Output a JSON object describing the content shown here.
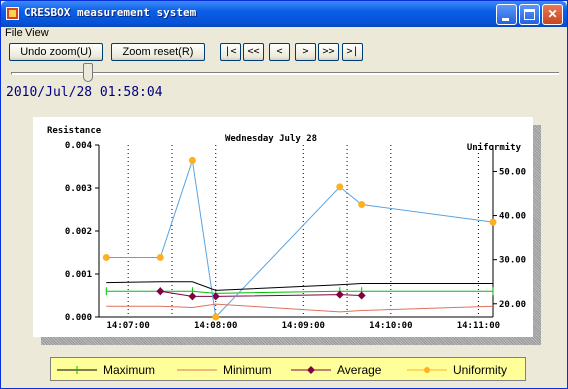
{
  "window": {
    "title": "CRESBOX measurement system",
    "min_glyph": "",
    "max_glyph": "",
    "close_glyph": "✕"
  },
  "menu": {
    "file": "File",
    "view": "View"
  },
  "toolbar": {
    "undo_zoom": "Undo zoom(U)",
    "zoom_reset": "Zoom reset(R)",
    "nav": [
      "|<",
      "<<",
      "<",
      ">",
      ">>",
      ">|"
    ]
  },
  "slider": {
    "value_fraction": 0.14
  },
  "timestamp": "2010/Jul/28 01:58:04",
  "colors": {
    "maximum": "#00c000",
    "minimum": "#e07060",
    "average": "#800040",
    "uniformity": "#ffb020",
    "uniformity_line": "#5ba3e0",
    "black_line": "#000000"
  },
  "chart_data": {
    "type": "line",
    "title": "Wednesday July 28",
    "ylabel": "Resistance",
    "y2label": "Uniformity",
    "xticks": [
      "14:07:00",
      "14:08:00",
      "14:09:00",
      "14:10:00",
      "14:11:00"
    ],
    "yticks": [
      "0.000",
      "0.001",
      "0.002",
      "0.003",
      "0.004"
    ],
    "y2ticks": [
      "20.00",
      "30.00",
      "40.00",
      "50.00"
    ],
    "ylim": [
      0,
      0.004
    ],
    "y2lim": [
      17,
      56
    ],
    "x": [
      "14:06:45",
      "14:07:22",
      "14:07:44",
      "14:08:00",
      "14:09:25",
      "14:09:40",
      "14:11:10"
    ],
    "series": [
      {
        "name": "Maximum",
        "axis": "y",
        "values": [
          0.0006,
          0.0006,
          0.0006,
          0.00055,
          0.0006,
          0.0006,
          0.0006
        ]
      },
      {
        "name": "Minimum",
        "axis": "y",
        "values": [
          0.00025,
          0.00025,
          0.00022,
          0.0003,
          0.00012,
          0.00015,
          0.00025
        ]
      },
      {
        "name": "Average",
        "axis": "y",
        "values": [
          null,
          0.0006,
          0.00048,
          0.00048,
          0.00052,
          0.0005,
          null
        ]
      },
      {
        "name": "Uniformity",
        "axis": "y2",
        "values": [
          30.5,
          30.5,
          52.5,
          17.0,
          46.5,
          42.5,
          38.5
        ]
      },
      {
        "name": "",
        "axis": "y",
        "values": [
          0.0008,
          0.00082,
          0.00082,
          0.00062,
          0.00075,
          0.00078,
          0.00078
        ]
      }
    ],
    "grid": "vertical-dotted",
    "legend_position": "bottom"
  }
}
